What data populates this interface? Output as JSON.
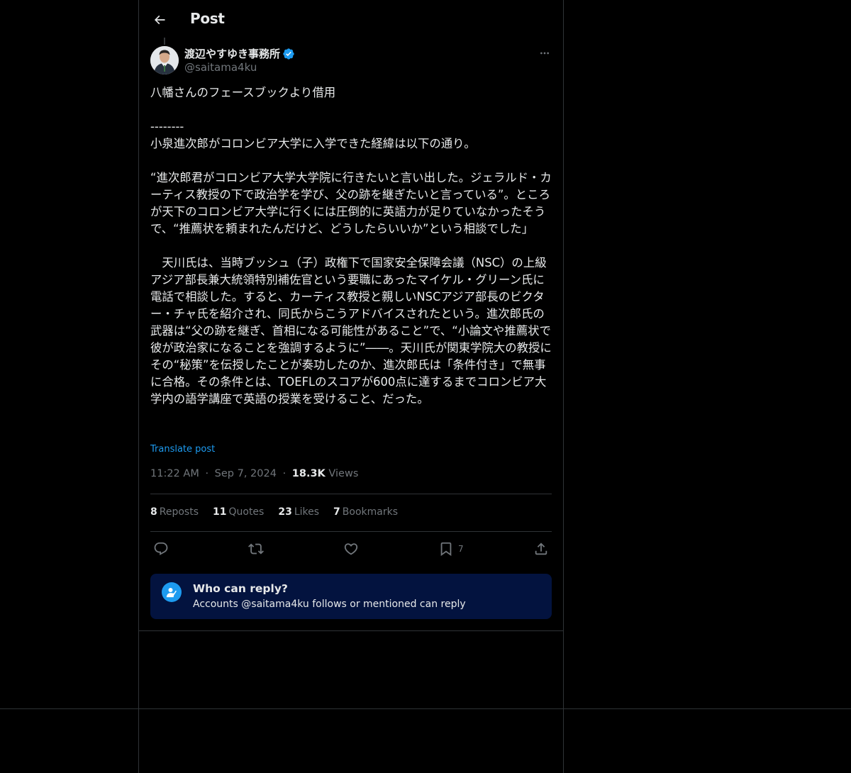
{
  "header": {
    "title": "Post"
  },
  "author": {
    "name": "渡辺やすゆき事務所",
    "handle": "@saitama4ku"
  },
  "post": {
    "text": "八幡さんのフェースブックより借用\n\n--------\n小泉進次郎がコロンビア大学に入学できた経緯は以下の通り。\n\n“進次郎君がコロンビア大学大学院に行きたいと言い出した。ジェラルド・カーティス教授の下で政治学を学び、父の跡を継ぎたいと言っている”。ところが天下のコロンビア大学に行くには圧倒的に英語力が足りていなかったそうで、“推薦状を頼まれたんだけど、どうしたらいいか”という相談でした」\n\n　天川氏は、当時ブッシュ（子）政権下で国家安全保障会議（NSC）の上級アジア部長兼大統領特別補佐官という要職にあったマイケル・グリーン氏に電話で相談した。すると、カーティス教授と親しいNSCアジア部長のビクター・チャ氏を紹介され、同氏からこうアドバイスされたという。進次郎氏の武器は“父の跡を継ぎ、首相になる可能性があること”で、“小論文や推薦状で彼が政治家になることを強調するように”――。天川氏が関東学院大の教授にその“秘策”を伝授したことが奏功したのか、進次郎氏は「条件付き」で無事に合格。その条件とは、TOEFLのスコアが600点に達するまでコロンビア大学内の語学講座で英語の授業を受けること、だった。",
    "translate_label": "Translate post",
    "time": "11:22 AM",
    "date": "Sep 7, 2024",
    "views_count": "18.3K",
    "views_label": "Views",
    "separator": "·"
  },
  "stats": {
    "reposts_count": "8",
    "reposts_label": "Reposts",
    "quotes_count": "11",
    "quotes_label": "Quotes",
    "likes_count": "23",
    "likes_label": "Likes",
    "bookmarks_count": "7",
    "bookmarks_label": "Bookmarks"
  },
  "actions": {
    "bookmark_count": "7",
    "icons": [
      "reply-icon",
      "repost-icon",
      "like-icon",
      "bookmark-icon",
      "share-icon"
    ]
  },
  "reply_settings": {
    "title": "Who can reply?",
    "subtitle": "Accounts @saitama4ku follows or mentioned can reply"
  },
  "colors": {
    "background": "#000000",
    "accent": "#1d9bf0",
    "muted": "#71767b",
    "box": "#03133f"
  }
}
